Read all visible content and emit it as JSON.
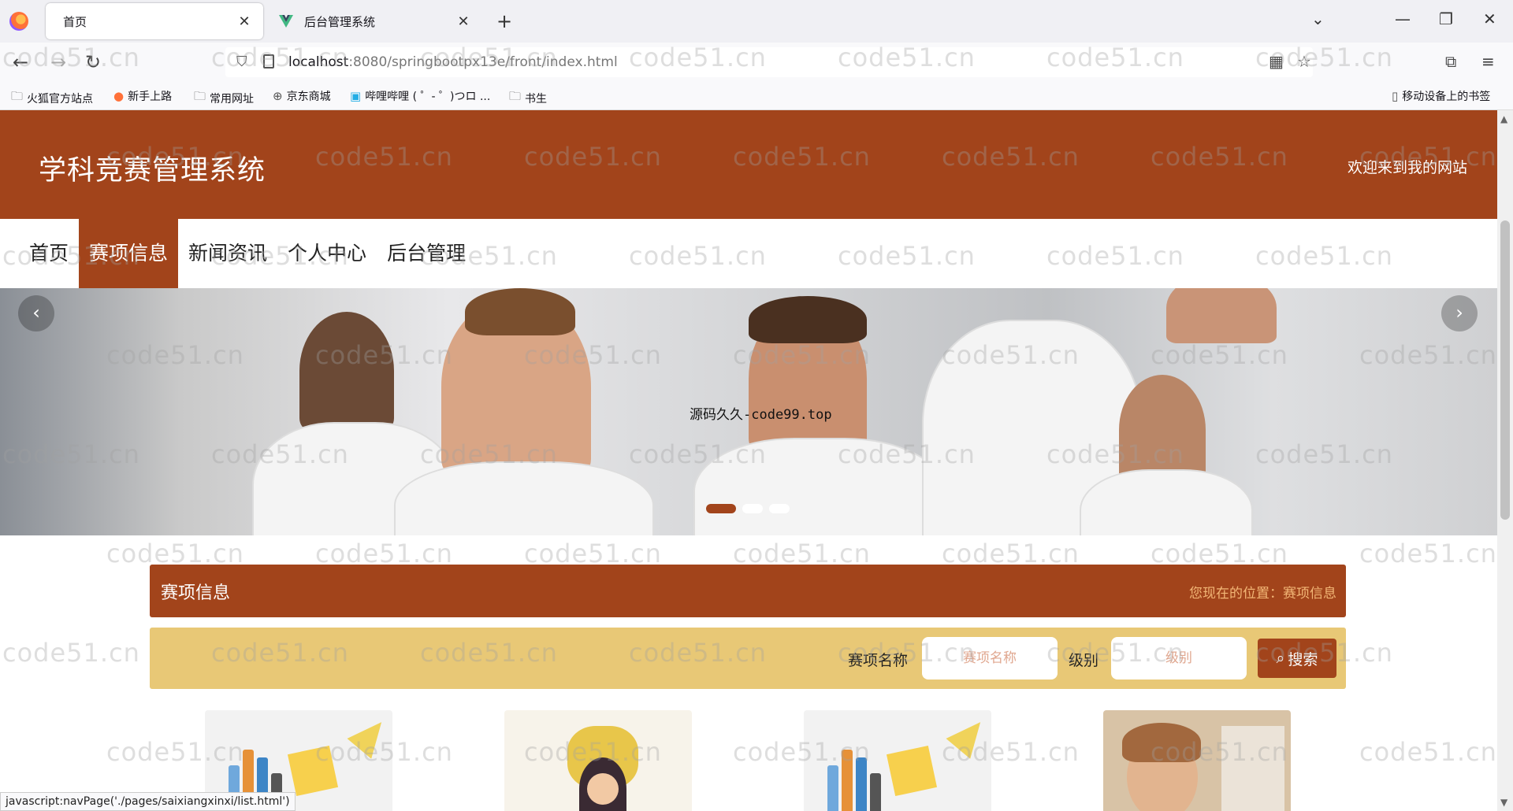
{
  "browser": {
    "tabs": [
      {
        "title": "首页",
        "active": true
      },
      {
        "title": "后台管理系统",
        "active": false
      }
    ],
    "url_host": "localhost",
    "url_rest": ":8080/springbootpx13e/front/index.html",
    "bookmarks": [
      "火狐官方站点",
      "新手上路",
      "常用网址",
      "京东商城",
      "哔哩哔哩 ( ゜- ゜)つロ ...",
      "书生"
    ],
    "mobile_bookmarks": "移动设备上的书签",
    "status_url": "javascript:navPage('./pages/saixiangxinxi/list.html')"
  },
  "site": {
    "title": "学科竞赛管理系统",
    "welcome": "欢迎来到我的网站"
  },
  "nav": {
    "items": [
      "首页",
      "赛项信息",
      "新闻资讯",
      "个人中心",
      "后台管理"
    ],
    "active_index": 1
  },
  "banner": {
    "caption": "源码久久-code99.top",
    "slide_count": 3,
    "active_slide": 0
  },
  "section": {
    "title": "赛项信息",
    "breadcrumb": "您现在的位置：赛项信息"
  },
  "search": {
    "name_label": "赛项名称",
    "name_placeholder": "赛项名称",
    "level_label": "级别",
    "level_placeholder": "级别",
    "button_label": "搜索"
  },
  "watermark": "code51.cn",
  "colors": {
    "brand": "#a2441b",
    "search_bg": "#e8c876",
    "crumb": "#f2b676"
  }
}
